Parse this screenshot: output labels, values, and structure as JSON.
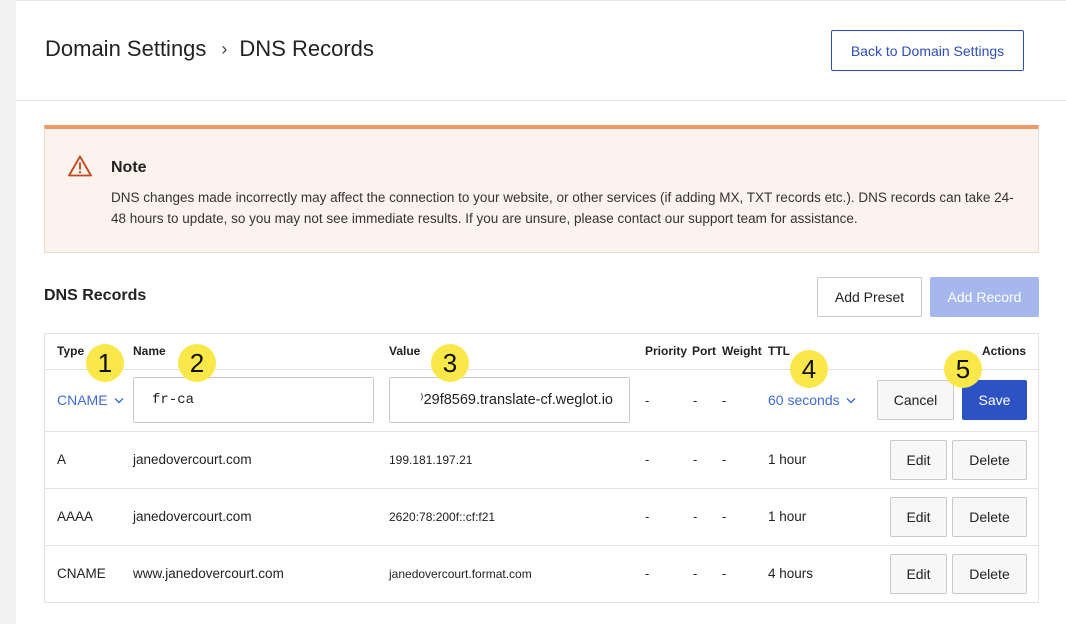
{
  "header": {
    "breadcrumb_parent": "Domain Settings",
    "breadcrumb_sep": "›",
    "breadcrumb_current": "DNS Records",
    "back_button": "Back to Domain Settings"
  },
  "note": {
    "icon": "warning-triangle-icon",
    "title": "Note",
    "text": "DNS changes made incorrectly may affect the connection to your website, or other services (if adding MX, TXT records etc.). DNS records can take 24-48 hours to update, so you may not see immediate results. If you are unsure, please contact our support team for assistance."
  },
  "section": {
    "title": "DNS Records",
    "add_preset": "Add Preset",
    "add_record": "Add Record"
  },
  "table": {
    "headers": {
      "type": "Type",
      "name": "Name",
      "value": "Value",
      "priority": "Priority",
      "port": "Port",
      "weight": "Weight",
      "ttl": "TTL",
      "actions": "Actions"
    },
    "edit_row": {
      "type": "CNAME",
      "name": "fr-ca",
      "value": "⁾29f8569.translate-cf.weglot.io",
      "priority": "-",
      "port": "-",
      "weight": "-",
      "ttl": "60 seconds",
      "cancel": "Cancel",
      "save": "Save"
    },
    "rows": [
      {
        "type": "A",
        "name": "janedovercourt.com",
        "value": "199.181.197.21",
        "priority": "-",
        "port": "-",
        "weight": "-",
        "ttl": "1 hour",
        "edit": "Edit",
        "delete": "Delete"
      },
      {
        "type": "AAAA",
        "name": "janedovercourt.com",
        "value": "2620:78:200f::cf:f21",
        "priority": "-",
        "port": "-",
        "weight": "-",
        "ttl": "1 hour",
        "edit": "Edit",
        "delete": "Delete"
      },
      {
        "type": "CNAME",
        "name": "www.janedovercourt.com",
        "value": "janedovercourt.format.com",
        "priority": "-",
        "port": "-",
        "weight": "-",
        "ttl": "4 hours",
        "edit": "Edit",
        "delete": "Delete"
      }
    ]
  },
  "callouts": [
    "1",
    "2",
    "3",
    "4",
    "5"
  ],
  "colors": {
    "accent": "#2d52c4",
    "link": "#3f6bd8",
    "note_border": "#ee9a66",
    "note_bg": "#fdf3ee",
    "callout": "#fae84a"
  }
}
